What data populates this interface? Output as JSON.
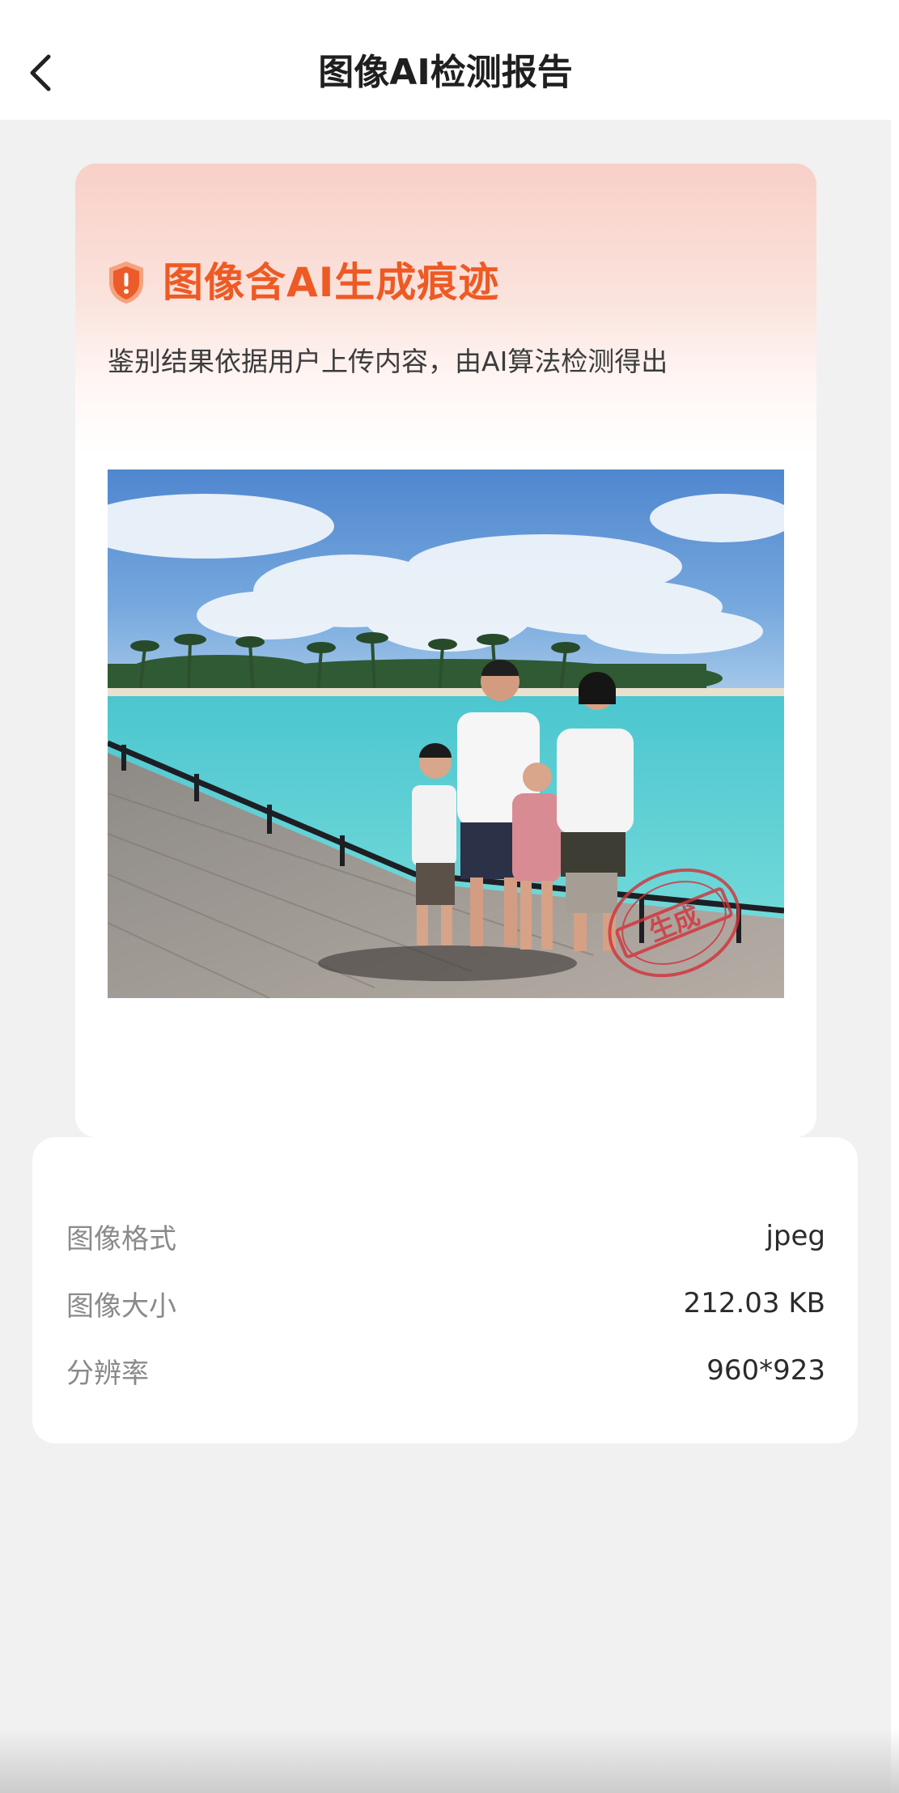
{
  "header": {
    "title": "图像AI检测报告",
    "back_icon": "chevron-left-icon"
  },
  "report": {
    "result_icon": "shield-alert-icon",
    "result_title": "图像含AI生成痕迹",
    "result_color": "#ee5a24",
    "subtitle": "鉴别结果依据用户上传内容，由AI算法检测得出",
    "stamp_text": "生成"
  },
  "info": {
    "rows": [
      {
        "label": "图像格式",
        "value": "jpeg"
      },
      {
        "label": "图像大小",
        "value": "212.03 KB"
      },
      {
        "label": "分辨率",
        "value": "960*923"
      }
    ]
  }
}
